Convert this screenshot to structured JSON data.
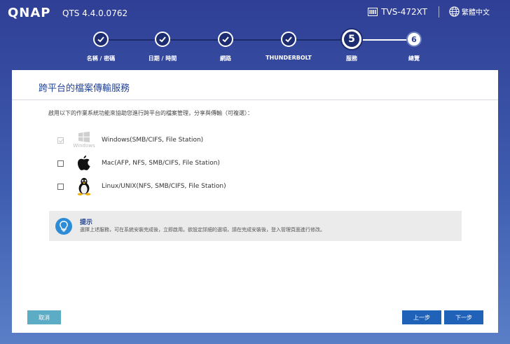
{
  "header": {
    "logo": "QNAP",
    "firmware": "QTS 4.4.0.0762",
    "device": "TVS-472XT",
    "language": "繁體中文"
  },
  "steps": [
    {
      "label": "名稱 / 密碼",
      "state": "done",
      "number": ""
    },
    {
      "label": "日期 / 時間",
      "state": "done",
      "number": ""
    },
    {
      "label": "網路",
      "state": "done",
      "number": ""
    },
    {
      "label": "THUNDERBOLT",
      "state": "done",
      "number": ""
    },
    {
      "label": "服務",
      "state": "current",
      "number": "5"
    },
    {
      "label": "總覽",
      "state": "todo",
      "number": "6"
    }
  ],
  "panel": {
    "title": "跨平台的檔案傳輸服務",
    "intro": "啟用以下的作業系統功能來協助您進行跨平台的檔案管理，分享與傳輸（可複選）：",
    "options": [
      {
        "label": "Windows(SMB/CIFS, File Station)",
        "icon": "windows-icon",
        "checked": true,
        "disabled": true,
        "icon_caption": "Windows"
      },
      {
        "label": "Mac(AFP, NFS, SMB/CIFS, File Station)",
        "icon": "apple-icon",
        "checked": false,
        "disabled": false
      },
      {
        "label": "Linux/UNIX(NFS, SMB/CIFS, File Station)",
        "icon": "linux-tux-icon",
        "checked": false,
        "disabled": false
      }
    ],
    "tip": {
      "title": "提示",
      "text": "選擇上述服務，可在系統安裝完成後，立即啟用。欲設定詳細的選項，請在完成安裝後，登入管理頁面進行修改。"
    }
  },
  "buttons": {
    "cancel": "取消",
    "prev": "上一步",
    "next": "下一步"
  },
  "colors": {
    "accent": "#22449a",
    "primary_button": "#1f62b8",
    "cancel_button": "#5dacc6",
    "tip_icon": "#2e8bd6"
  }
}
